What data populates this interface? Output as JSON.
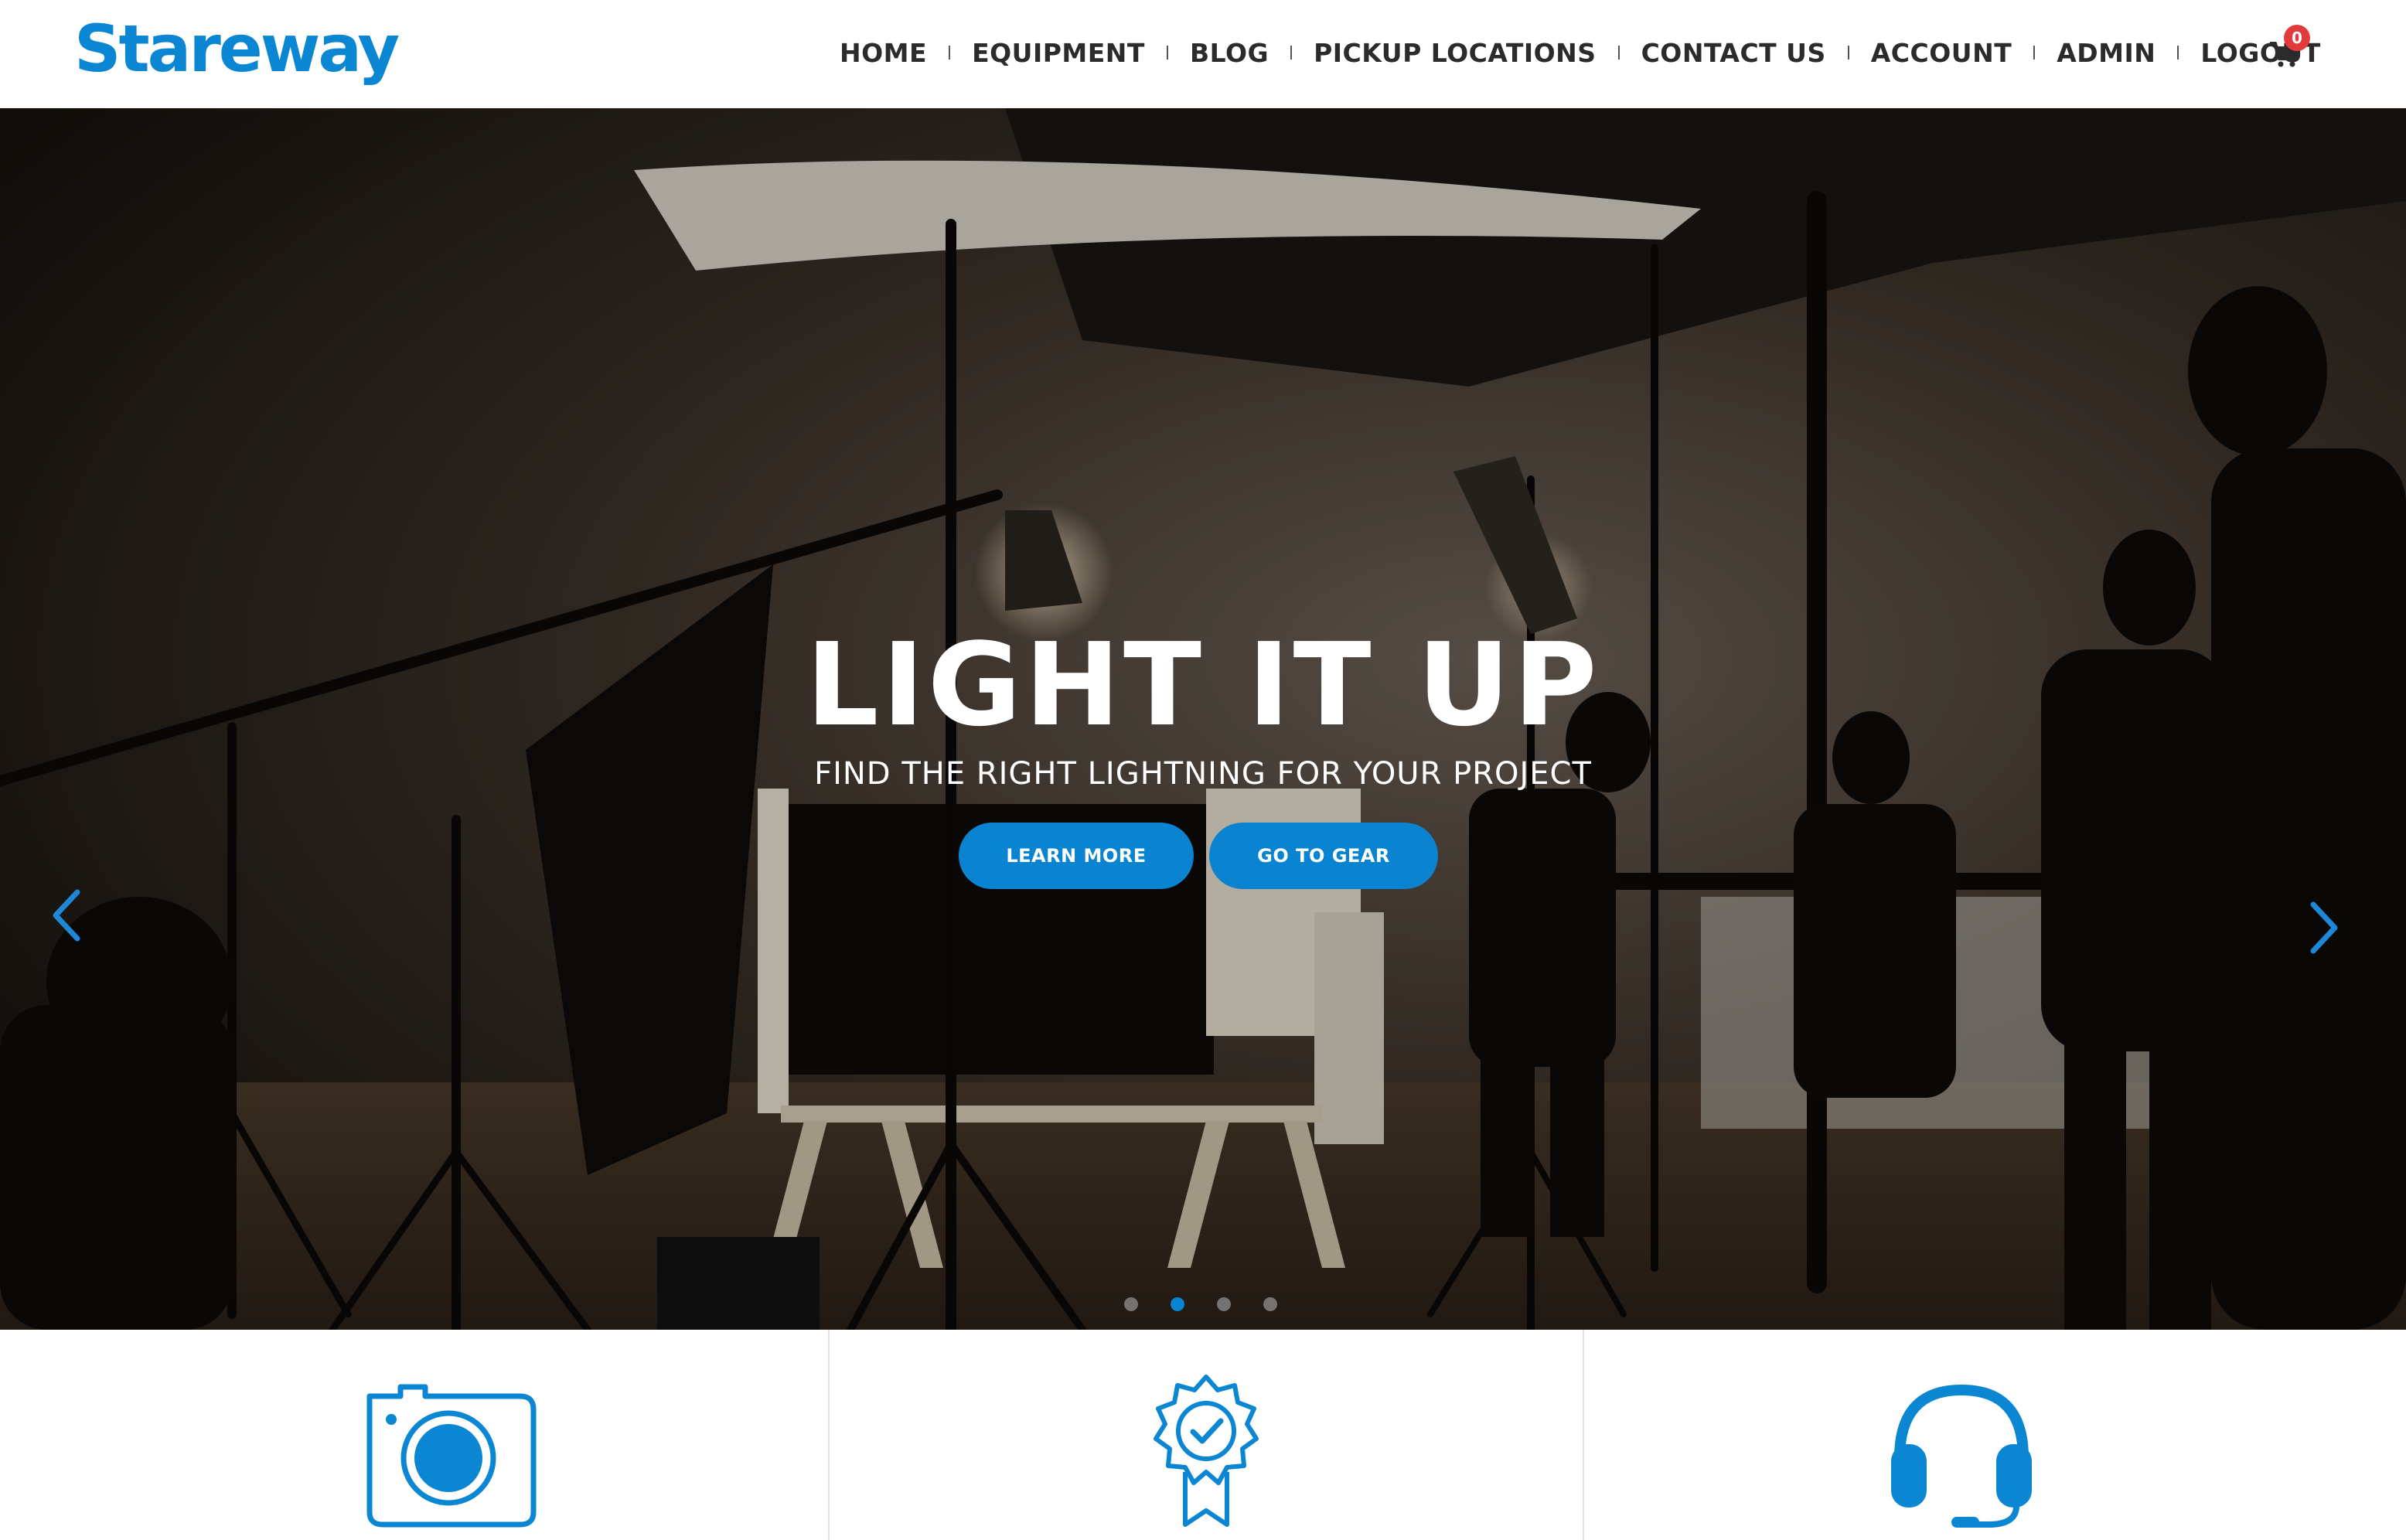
{
  "brand": {
    "logo_text": "Stareway",
    "accent_color": "#0a86d3",
    "badge_color": "#e33b3b"
  },
  "nav": {
    "items": [
      {
        "label": "HOME"
      },
      {
        "label": "EQUIPMENT"
      },
      {
        "label": "BLOG"
      },
      {
        "label": "PICKUP LOCATIONS"
      },
      {
        "label": "CONTACT US"
      },
      {
        "label": "ACCOUNT"
      },
      {
        "label": "ADMIN"
      },
      {
        "label": "LOGOUT"
      }
    ],
    "cart_icon": "cart-icon",
    "cart_count": "0"
  },
  "hero": {
    "title": "LIGHT IT UP",
    "subtitle": "FIND THE RIGHT LIGHTNING FOR YOUR PROJECT",
    "learn_more_label": "LEARN MORE",
    "go_to_gear_label": "GO TO GEAR",
    "prev_icon": "chevron-left-icon",
    "next_icon": "chevron-right-icon",
    "slide_count": 4,
    "active_slide": 2
  },
  "features": [
    {
      "icon": "camera-icon"
    },
    {
      "icon": "award-badge-icon"
    },
    {
      "icon": "headset-icon"
    }
  ]
}
